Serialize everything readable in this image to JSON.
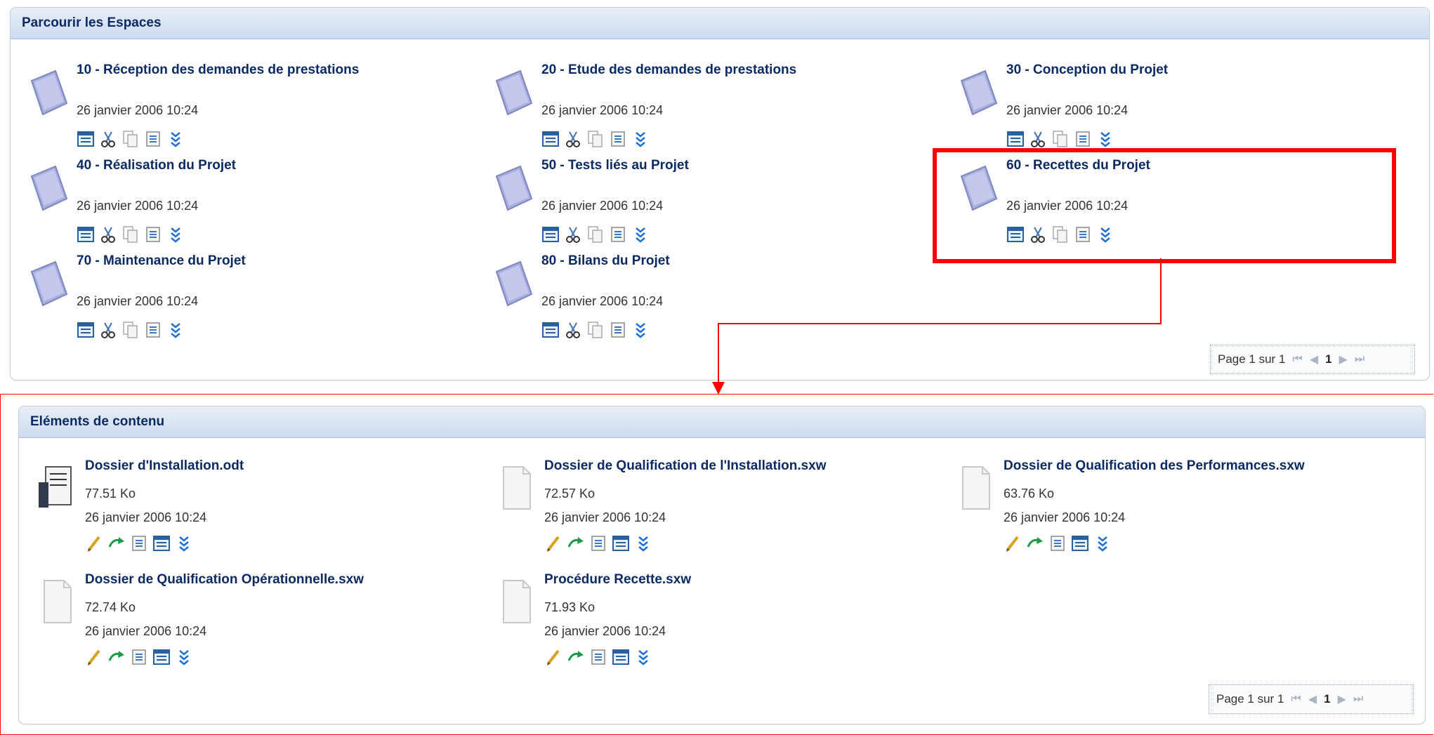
{
  "spaces_panel": {
    "title": "Parcourir les Espaces",
    "items": [
      {
        "title": "10 - Réception des demandes de prestations",
        "date": "26 janvier 2006 10:24"
      },
      {
        "title": "20 - Etude des demandes de prestations",
        "date": "26 janvier 2006 10:24"
      },
      {
        "title": "30 - Conception du Projet",
        "date": "26 janvier 2006 10:24"
      },
      {
        "title": "40 - Réalisation du Projet",
        "date": "26 janvier 2006 10:24"
      },
      {
        "title": "50 - Tests liés au Projet",
        "date": "26 janvier 2006 10:24"
      },
      {
        "title": "60 - Recettes du Projet",
        "date": "26 janvier 2006 10:24"
      },
      {
        "title": "70 - Maintenance du Projet",
        "date": "26 janvier 2006 10:24"
      },
      {
        "title": "80 - Bilans du Projet",
        "date": "26 janvier 2006 10:24"
      }
    ],
    "pager": {
      "text": "Page 1 sur 1",
      "current": "1"
    }
  },
  "content_panel": {
    "title": "Eléments de contenu",
    "items": [
      {
        "title": "Dossier d'Installation.odt",
        "size": "77.51 Ko",
        "date": "26 janvier 2006 10:24"
      },
      {
        "title": "Dossier de Qualification de l'Installation.sxw",
        "size": "72.57 Ko",
        "date": "26 janvier 2006 10:24"
      },
      {
        "title": "Dossier de Qualification des Performances.sxw",
        "size": "63.76 Ko",
        "date": "26 janvier 2006 10:24"
      },
      {
        "title": "Dossier de Qualification Opérationnelle.sxw",
        "size": "72.74 Ko",
        "date": "26 janvier 2006 10:24"
      },
      {
        "title": "Procédure Recette.sxw",
        "size": "71.93 Ko",
        "date": "26 janvier 2006 10:24"
      }
    ],
    "pager": {
      "text": "Page 1 sur 1",
      "current": "1"
    }
  },
  "icons": {
    "space_actions": [
      "details-icon",
      "cut-icon",
      "copy-icon",
      "preview-icon",
      "more-actions-icon"
    ],
    "content_actions": [
      "edit-icon",
      "update-icon",
      "preview-icon",
      "details-icon",
      "more-actions-icon"
    ],
    "pager": [
      "first-page-icon",
      "previous-page-icon",
      "next-page-icon",
      "last-page-icon"
    ]
  },
  "colors": {
    "accent": "#0b2a63",
    "header_bg": "#cddcf0",
    "highlight": "#ff0000"
  }
}
